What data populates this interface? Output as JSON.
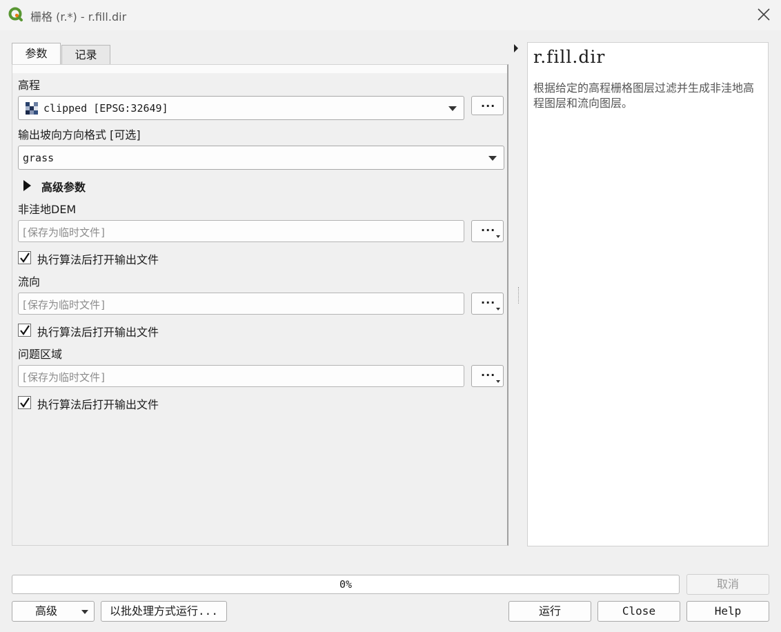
{
  "window": {
    "title": "栅格 (r.*) - r.fill.dir"
  },
  "tabs": [
    {
      "label": "参数",
      "active": true
    },
    {
      "label": "记录",
      "active": false
    }
  ],
  "params": {
    "elevation": {
      "label": "高程",
      "value": "clipped [EPSG:32649]",
      "button": "···"
    },
    "format": {
      "label": "输出坡向方向格式 [可选]",
      "value": "grass"
    },
    "advanced": {
      "label": "高级参数"
    },
    "outputs": [
      {
        "label": "非洼地DEM",
        "placeholder": "[保存为临时文件]",
        "button": "···",
        "open_label": "执行算法后打开输出文件",
        "checked": true
      },
      {
        "label": "流向",
        "placeholder": "[保存为临时文件]",
        "button": "···",
        "open_label": "执行算法后打开输出文件",
        "checked": true
      },
      {
        "label": "问题区域",
        "placeholder": "[保存为临时文件]",
        "button": "···",
        "open_label": "执行算法后打开输出文件",
        "checked": true
      }
    ]
  },
  "help": {
    "title": "r.fill.dir",
    "description": "根据给定的高程栅格图层过滤并生成非洼地高程图层和流向图层。"
  },
  "progress": {
    "text": "0%",
    "value": 0
  },
  "buttons": {
    "cancel": "取消",
    "advanced": "高级",
    "batch": "以批处理方式运行...",
    "run": "运行",
    "close": "Close",
    "help": "Help"
  },
  "colors": {
    "qgis_green": "#589632",
    "qgis_yellow": "#ee7913"
  }
}
